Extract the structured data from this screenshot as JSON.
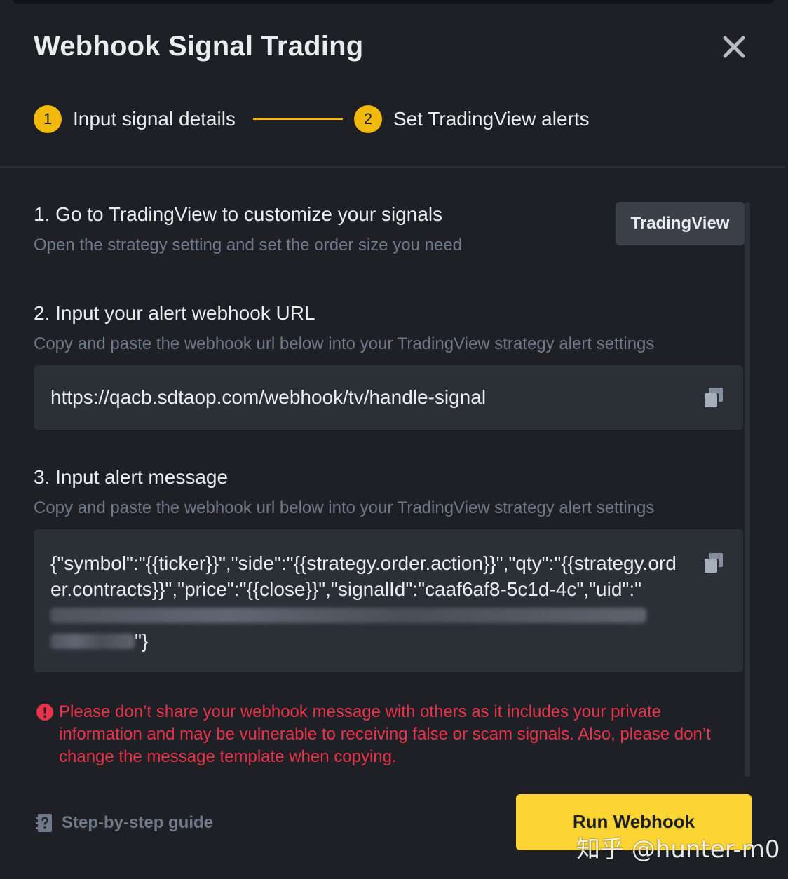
{
  "modal": {
    "title": "Webhook Signal Trading"
  },
  "stepper": {
    "steps": [
      {
        "number": "1",
        "label": "Input signal details"
      },
      {
        "number": "2",
        "label": "Set TradingView alerts"
      }
    ]
  },
  "sections": {
    "s1": {
      "title": "1. Go to TradingView to customize your signals",
      "desc": "Open the strategy setting and set the order size you need",
      "button_label": "TradingView"
    },
    "s2": {
      "title": "2. Input your alert webhook URL",
      "desc": "Copy and paste the webhook url below into your TradingView strategy alert settings",
      "url": "https://qacb.sdtaop.com/webhook/tv/handle-signal"
    },
    "s3": {
      "title": "3. Input alert message",
      "desc": "Copy and paste the webhook url below into your TradingView strategy alert settings",
      "message_visible": "{\"symbol\":\"{{ticker}}\",\"side\":\"{{strategy.order.action}}\",\"qty\":\"{{strategy.order.contracts}}\",\"price\":\"{{close}}\",\"signalId\":\"caaf6af8-5c1d-4c\",\"uid\":\"",
      "message_end": "\"}"
    }
  },
  "warning": {
    "text": "Please don’t share your webhook message with others as it includes your private information and may be vulnerable to receiving false or scam signals. Also, please don’t change the message template when copying."
  },
  "footer": {
    "guide_label": "Step-by-step guide",
    "run_label": "Run Webhook"
  },
  "watermark": "知乎 @hunter-m0",
  "colors": {
    "accent": "#f0b90b",
    "button_yellow": "#fcd535",
    "warning_red": "#e8344a",
    "background": "#1e2026",
    "box": "#2b2f36"
  }
}
